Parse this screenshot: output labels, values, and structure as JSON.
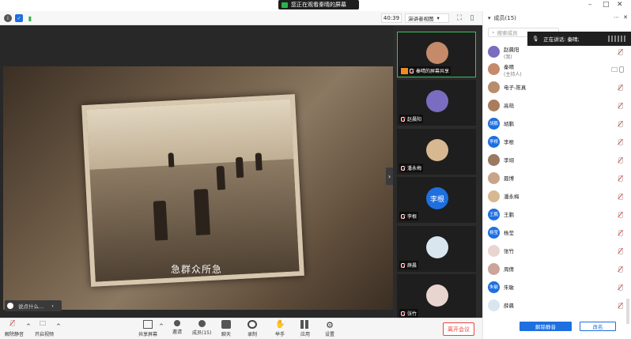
{
  "top": {
    "share_banner": "您正在观看秦晴的屏幕",
    "timer": "40:39",
    "view_button": "演讲者视图",
    "panel_title": "成员(15)"
  },
  "main": {
    "subtitle": "急群众所急",
    "chat_placeholder": "说点什么..."
  },
  "thumbnails": [
    {
      "label": "秦晴的屏幕共享",
      "initial": "",
      "color": "#c58a6a",
      "active": true
    },
    {
      "label": "赵晨阳",
      "initial": "",
      "color": "#7a6cc0",
      "active": false
    },
    {
      "label": "潘永梅",
      "initial": "",
      "color": "#d8b890",
      "active": false
    },
    {
      "label": "李根",
      "initial": "李根",
      "color": "#1e6fe0",
      "active": false
    },
    {
      "label": "薛晨",
      "initial": "",
      "color": "#d9e6ef",
      "active": false
    },
    {
      "label": "张竹",
      "initial": "",
      "color": "#e9d5cf",
      "active": false
    }
  ],
  "panel": {
    "search_placeholder": "搜索成员",
    "speaking": "正在讲话: 秦晴;",
    "members": [
      {
        "name": "赵晨阳",
        "role": "(我)",
        "initial": "",
        "color": "#7a6cc0",
        "mic": "off"
      },
      {
        "name": "秦晴",
        "role": "(主持人)",
        "initial": "",
        "color": "#c58a6a",
        "mic": "on"
      },
      {
        "name": "电子-陈真",
        "role": "",
        "initial": "",
        "color": "#b88c6c",
        "mic": "off"
      },
      {
        "name": "高萌",
        "role": "",
        "initial": "",
        "color": "#a87c5c",
        "mic": "off"
      },
      {
        "name": "胡鹏",
        "role": "",
        "initial": "胡鹏",
        "color": "#1e6fe0",
        "mic": "off"
      },
      {
        "name": "李根",
        "role": "",
        "initial": "李根",
        "color": "#1e6fe0",
        "mic": "off"
      },
      {
        "name": "李翊",
        "role": "",
        "initial": "",
        "color": "#9a7a60",
        "mic": "off"
      },
      {
        "name": "聂博",
        "role": "",
        "initial": "",
        "color": "#c8a58a",
        "mic": "off"
      },
      {
        "name": "潘永梅",
        "role": "",
        "initial": "",
        "color": "#d8b890",
        "mic": "off"
      },
      {
        "name": "王鹏",
        "role": "",
        "initial": "王鹏",
        "color": "#1e6fe0",
        "mic": "off"
      },
      {
        "name": "杨莹",
        "role": "",
        "initial": "杨莹",
        "color": "#1e6fe0",
        "mic": "off"
      },
      {
        "name": "张竹",
        "role": "",
        "initial": "",
        "color": "#e9d5cf",
        "mic": "off"
      },
      {
        "name": "周倩",
        "role": "",
        "initial": "",
        "color": "#caa598",
        "mic": "off"
      },
      {
        "name": "朱敏",
        "role": "",
        "initial": "朱敏",
        "color": "#1e6fe0",
        "mic": "off"
      },
      {
        "name": "薛晨",
        "role": "",
        "initial": "",
        "color": "#d9e6ef",
        "mic": "off"
      }
    ],
    "mute_all": "解除静音",
    "rename": "改名"
  },
  "bottombar": {
    "unmute": "解除静音",
    "start_video": "开启视频",
    "share": "共享屏幕",
    "invite": "邀请",
    "members": "成员(15)",
    "chat": "聊天",
    "record": "录制",
    "raise": "举手",
    "apps": "应用",
    "settings": "设置",
    "leave": "离开会议"
  }
}
